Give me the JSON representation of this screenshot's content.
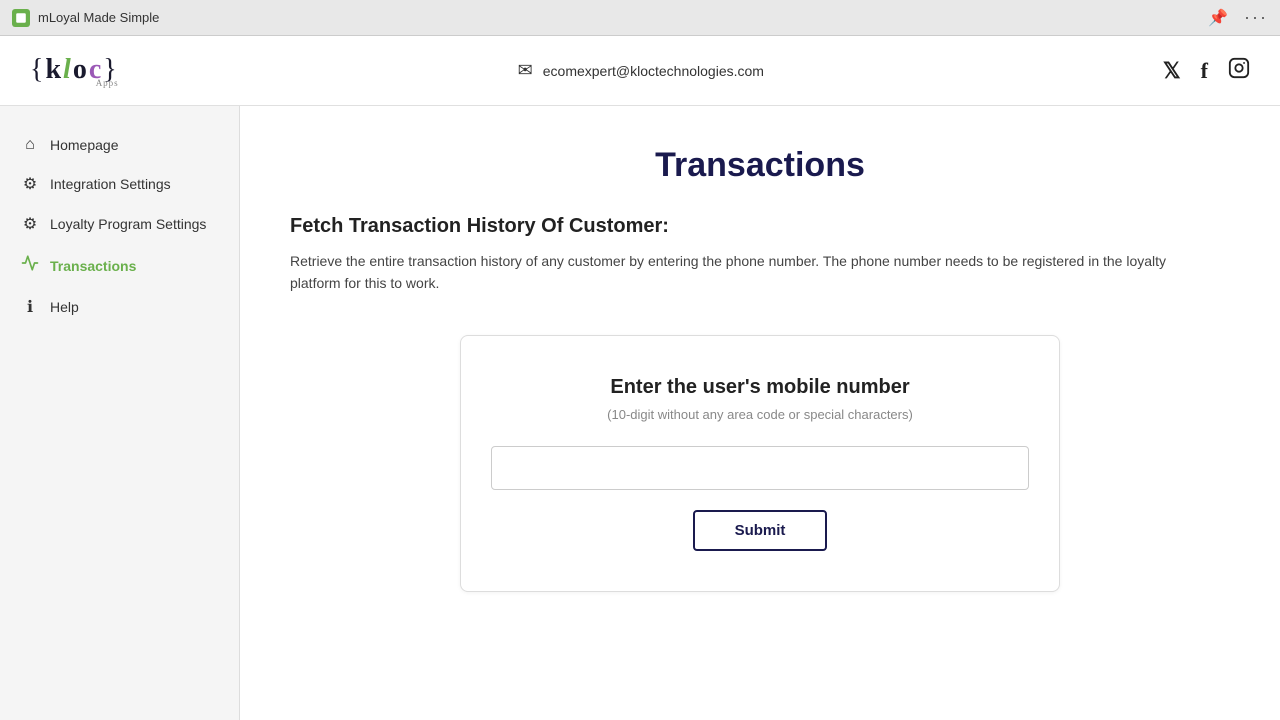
{
  "browser": {
    "tab_label": "mLoyal Made Simple",
    "pin_icon": "📌",
    "more_icon": "···"
  },
  "header": {
    "logo_text": "{kloc}",
    "logo_sub": "Apps",
    "email_icon": "✉",
    "email": "ecomexpert@kloctechnologies.com",
    "social": {
      "twitter": "𝕏",
      "facebook": "f",
      "instagram": "⬡"
    }
  },
  "sidebar": {
    "items": [
      {
        "id": "homepage",
        "label": "Homepage",
        "icon": "⌂",
        "active": false
      },
      {
        "id": "integration-settings",
        "label": "Integration Settings",
        "icon": "⚙",
        "active": false
      },
      {
        "id": "loyalty-program-settings",
        "label": "Loyalty Program Settings",
        "icon": "⚙",
        "active": false
      },
      {
        "id": "transactions",
        "label": "Transactions",
        "icon": "📊",
        "active": true
      },
      {
        "id": "help",
        "label": "Help",
        "icon": "ℹ",
        "active": false
      }
    ]
  },
  "main": {
    "page_title": "Transactions",
    "section_title": "Fetch Transaction History Of Customer:",
    "section_desc": "Retrieve the entire transaction history of any customer by entering the phone number. The phone number needs to be registered in the loyalty platform for this to work.",
    "card": {
      "title": "Enter the user's mobile number",
      "subtitle": "(10-digit without any area code or special characters)",
      "input_placeholder": "",
      "submit_label": "Submit"
    }
  }
}
